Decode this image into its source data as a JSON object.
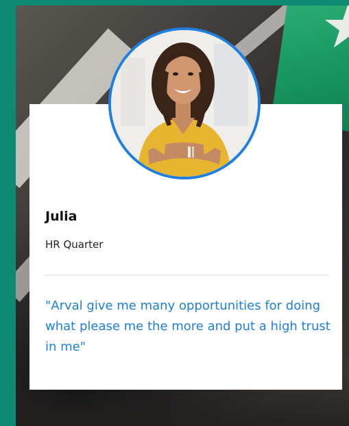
{
  "testimonial": {
    "name": "Julia",
    "role": "HR Quarter",
    "quote": "\"Arval give me many opportunities for doing what please me the more and put a high trust in me\""
  },
  "colors": {
    "accent": "#1f7fe0",
    "side_bar": "#0f8a72"
  }
}
